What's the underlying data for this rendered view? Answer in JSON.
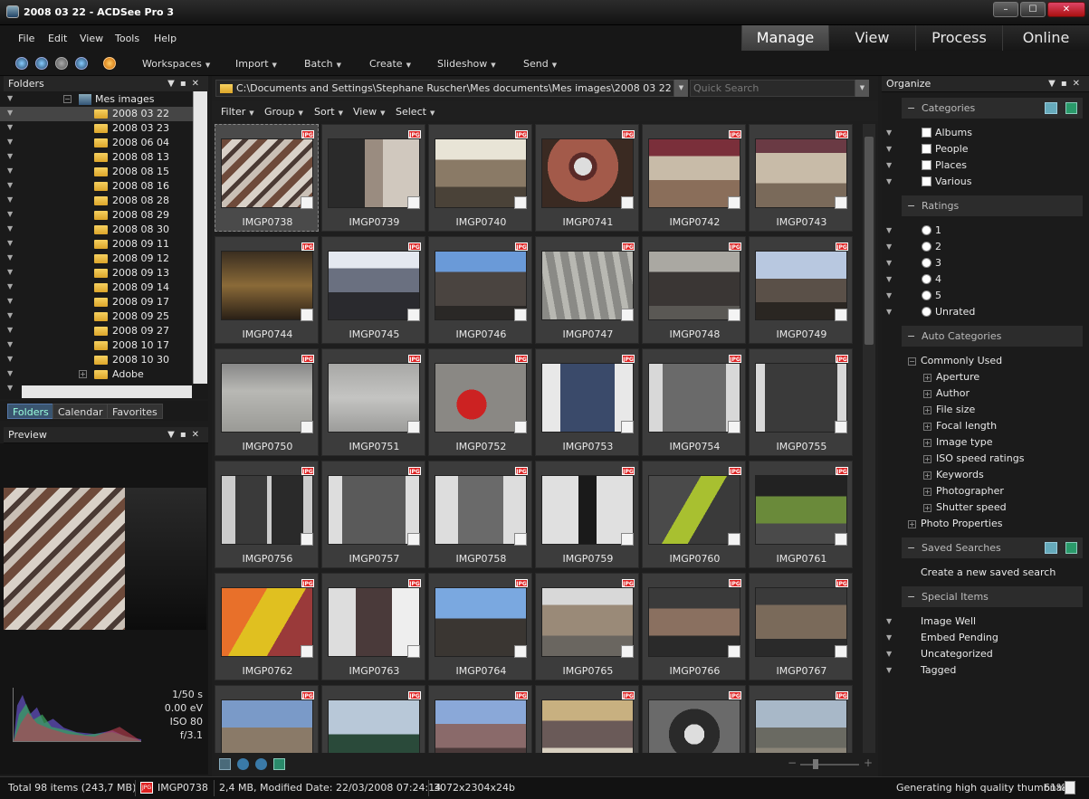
{
  "window": {
    "title": "2008 03 22 - ACDSee Pro 3",
    "min": "–",
    "max": "☐",
    "close": "✕"
  },
  "menu": [
    "File",
    "Edit",
    "View",
    "Tools",
    "Help"
  ],
  "modes": [
    {
      "label": "Manage",
      "active": true
    },
    {
      "label": "View",
      "active": false
    },
    {
      "label": "Process",
      "active": false
    },
    {
      "label": "Online",
      "active": false
    }
  ],
  "toolbar": {
    "items": [
      "Workspaces",
      "Import",
      "Batch",
      "Create",
      "Slideshow",
      "Send"
    ]
  },
  "folders": {
    "title": "Folders",
    "root": "Mes images",
    "items": [
      "2008 03 22",
      "2008 03 23",
      "2008 06 04",
      "2008 08 13",
      "2008 08 15",
      "2008 08 16",
      "2008 08 28",
      "2008 08 29",
      "2008 08 30",
      "2008 09 11",
      "2008 09 12",
      "2008 09 13",
      "2008 09 14",
      "2008 09 17",
      "2008 09 25",
      "2008 09 27",
      "2008 10 17",
      "2008 10 30",
      "Adobe"
    ],
    "selected": "2008 03 22"
  },
  "panel_tabs": [
    {
      "label": "Folders",
      "active": true
    },
    {
      "label": "Calendar",
      "active": false
    },
    {
      "label": "Favorites",
      "active": false
    }
  ],
  "preview": {
    "title": "Preview",
    "shutter": "1/50 s",
    "ev": "0.00 eV",
    "iso": "ISO 80",
    "aperture": "f/3.1"
  },
  "path": "C:\\Documents and Settings\\Stephane Ruscher\\Mes documents\\Mes images\\2008 03 22",
  "search": {
    "placeholder": "Quick Search"
  },
  "filterbar": [
    "Filter",
    "Group",
    "Sort",
    "View",
    "Select"
  ],
  "thumbs": [
    "IMGP0738",
    "IMGP0739",
    "IMGP0740",
    "IMGP0741",
    "IMGP0742",
    "IMGP0743",
    "IMGP0744",
    "IMGP0745",
    "IMGP0746",
    "IMGP0747",
    "IMGP0748",
    "IMGP0749",
    "IMGP0750",
    "IMGP0751",
    "IMGP0752",
    "IMGP0753",
    "IMGP0754",
    "IMGP0755",
    "IMGP0756",
    "IMGP0757",
    "IMGP0758",
    "IMGP0759",
    "IMGP0760",
    "IMGP0761",
    "IMGP0762",
    "IMGP0763",
    "IMGP0764",
    "IMGP0765",
    "IMGP0766",
    "IMGP0767",
    "",
    "",
    "",
    "",
    "",
    ""
  ],
  "thumb_badge": "JPG",
  "organize": {
    "title": "Organize",
    "categories_title": "Categories",
    "categories": [
      "Albums",
      "People",
      "Places",
      "Various"
    ],
    "ratings_title": "Ratings",
    "ratings": [
      "1",
      "2",
      "3",
      "4",
      "5",
      "Unrated"
    ],
    "auto_title": "Auto Categories",
    "commonly_used": "Commonly Used",
    "auto_items": [
      "Aperture",
      "Author",
      "File size",
      "Focal length",
      "Image type",
      "ISO speed ratings",
      "Keywords",
      "Photographer",
      "Shutter speed"
    ],
    "photo_props": "Photo Properties",
    "saved_title": "Saved Searches",
    "saved_create": "Create a new saved search",
    "special_title": "Special Items",
    "special_items": [
      "Image Well",
      "Embed Pending",
      "Uncategorized",
      "Tagged"
    ]
  },
  "status": {
    "total": "Total 98 items  (243,7 MB)",
    "file": "IMGP0738",
    "info": "2,4 MB, Modified Date: 22/03/2008 07:24:14",
    "dims": "3072x2304x24b",
    "progress_text": "Generating high quality thumbnail",
    "progress_pct": "61%"
  }
}
